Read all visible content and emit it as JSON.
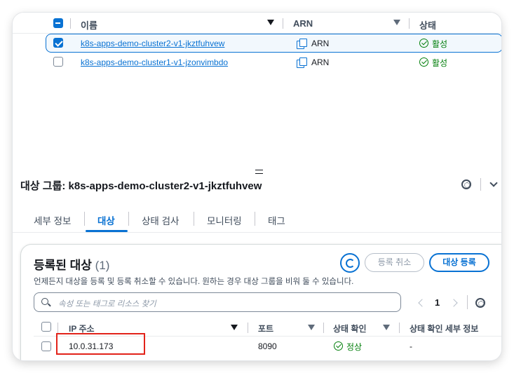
{
  "top_table": {
    "headers": {
      "name": "이름",
      "arn": "ARN",
      "status": "상태"
    },
    "rows": [
      {
        "name": "k8s-apps-demo-cluster2-v1-jkztfuhvew",
        "arn": "ARN",
        "status": "활성",
        "selected": true
      },
      {
        "name": "k8s-apps-demo-cluster1-v1-jzonvimbdo",
        "arn": "ARN",
        "status": "활성",
        "selected": false
      }
    ]
  },
  "panel": {
    "title": "대상 그룹: k8s-apps-demo-cluster2-v1-jkztfuhvew",
    "tabs": [
      "세부 정보",
      "대상",
      "상태 검사",
      "모니터링",
      "태그"
    ],
    "active_tab": "대상"
  },
  "targets": {
    "title": "등록된 대상",
    "count": "(1)",
    "description": "언제든지 대상을 등록 및 등록 취소할 수 있습니다. 원하는 경우 대상 그룹을 비워 둘 수 있습니다.",
    "deregister_label": "등록 취소",
    "register_label": "대상 등록",
    "search_placeholder": "속성 또는 태그로 리소스 찾기",
    "page": "1",
    "columns": [
      "IP 주소",
      "포트",
      "상태 확인",
      "상태 확인 세부 정보"
    ],
    "rows": [
      {
        "ip": "10.0.31.173",
        "port": "8090",
        "health": "정상",
        "health_detail": "-"
      }
    ]
  },
  "colors": {
    "accent": "#0972d3",
    "success": "#037f0c",
    "highlight": "#e2231a"
  },
  "icons": [
    "copy-icon",
    "status-ok-icon",
    "settings-gear-icon",
    "chevron-down-icon",
    "refresh-icon",
    "search-icon"
  ]
}
